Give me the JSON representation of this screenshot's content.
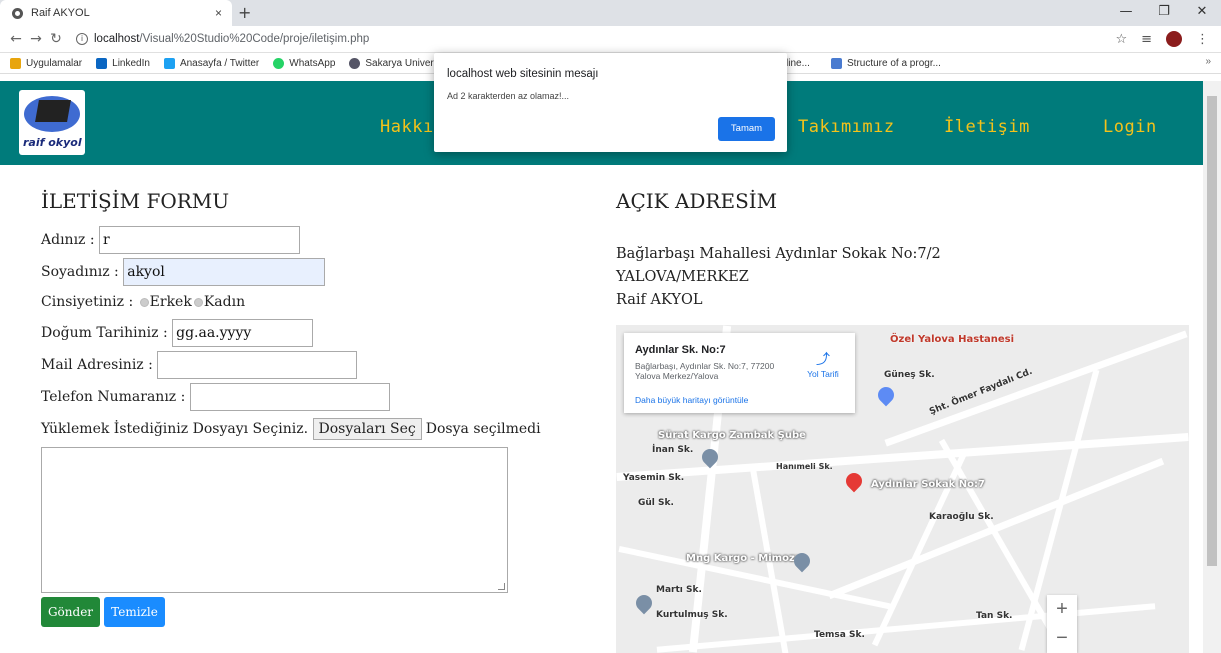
{
  "browser": {
    "tab_title": "Raif AKYOL",
    "tab_close": "×",
    "new_tab": "+",
    "url_host": "localhost",
    "url_path": "/Visual%20Studio%20Code/proje/iletişim.php",
    "bookmarks": [
      "Uygulamalar",
      "LinkedIn",
      "Anasayfa / Twitter",
      "WhatsApp",
      "Sakarya Univers",
      "line...",
      "Structure of a progr..."
    ],
    "bookmarks_more": "»"
  },
  "header": {
    "logo_text": "raif okyol",
    "menu": [
      "Hakkı",
      "Takımımız",
      "İletişim",
      "Login"
    ],
    "menu_color": "#f4c21a",
    "bg_color": "#007b7b"
  },
  "alert": {
    "title": "localhost web sitesinin mesajı",
    "message": "Ad 2 karakterden az olamaz!...",
    "ok_label": "Tamam"
  },
  "form": {
    "heading": "İLETİŞİM FORMU",
    "name_label": "Adınız :",
    "name_value": "r",
    "surname_label": "Soyadınız :",
    "surname_value": "akyol",
    "gender_label": "Cinsiyetiniz :",
    "gender_options": [
      "Erkek",
      "Kadın"
    ],
    "birth_label": "Doğum Tarihiniz :",
    "birth_value": "gg.aa.yyyy",
    "mail_label": "Mail Adresiniz :",
    "phone_label": "Telefon Numaranız :",
    "file_label": "Yüklemek İstediğiniz Dosyayı Seçiniz.",
    "file_button": "Dosyaları Seç",
    "file_status": "Dosya seçilmedi",
    "submit_label": "Gönder",
    "clear_label": "Temizle"
  },
  "address": {
    "heading": "AÇIK ADRESİM",
    "line1": "Bağlarbaşı Mahallesi Aydınlar Sokak No:7/2",
    "line2": "YALOVA/MERKEZ",
    "line3": "Raif AKYOL"
  },
  "map": {
    "card_title": "Aydınlar Sk. No:7",
    "card_address": "Bağlarbaşı, Aydınlar Sk. No:7, 77200 Yalova Merkez/Yalova",
    "card_directions": "Yol Tarifi",
    "card_link": "Daha büyük haritayı görüntüle",
    "labels": [
      "Özel Yalova Hastanesi",
      "Sürat Kargo Zambak Şube",
      "Aydınlar Sokak No:7",
      "Mng Kargo - Mimoza",
      "İnan Sk.",
      "Yasemin Sk.",
      "Gül Sk.",
      "Hanımeli Sk.",
      "Karaoğlu Sk.",
      "Martı Sk.",
      "Kurtulmuş Sk.",
      "Temsa Sk.",
      "Tan Sk.",
      "Güneş Sk.",
      "Şht. Ömer Faydalı Cd."
    ],
    "zoom_in": "+",
    "zoom_out": "−"
  }
}
